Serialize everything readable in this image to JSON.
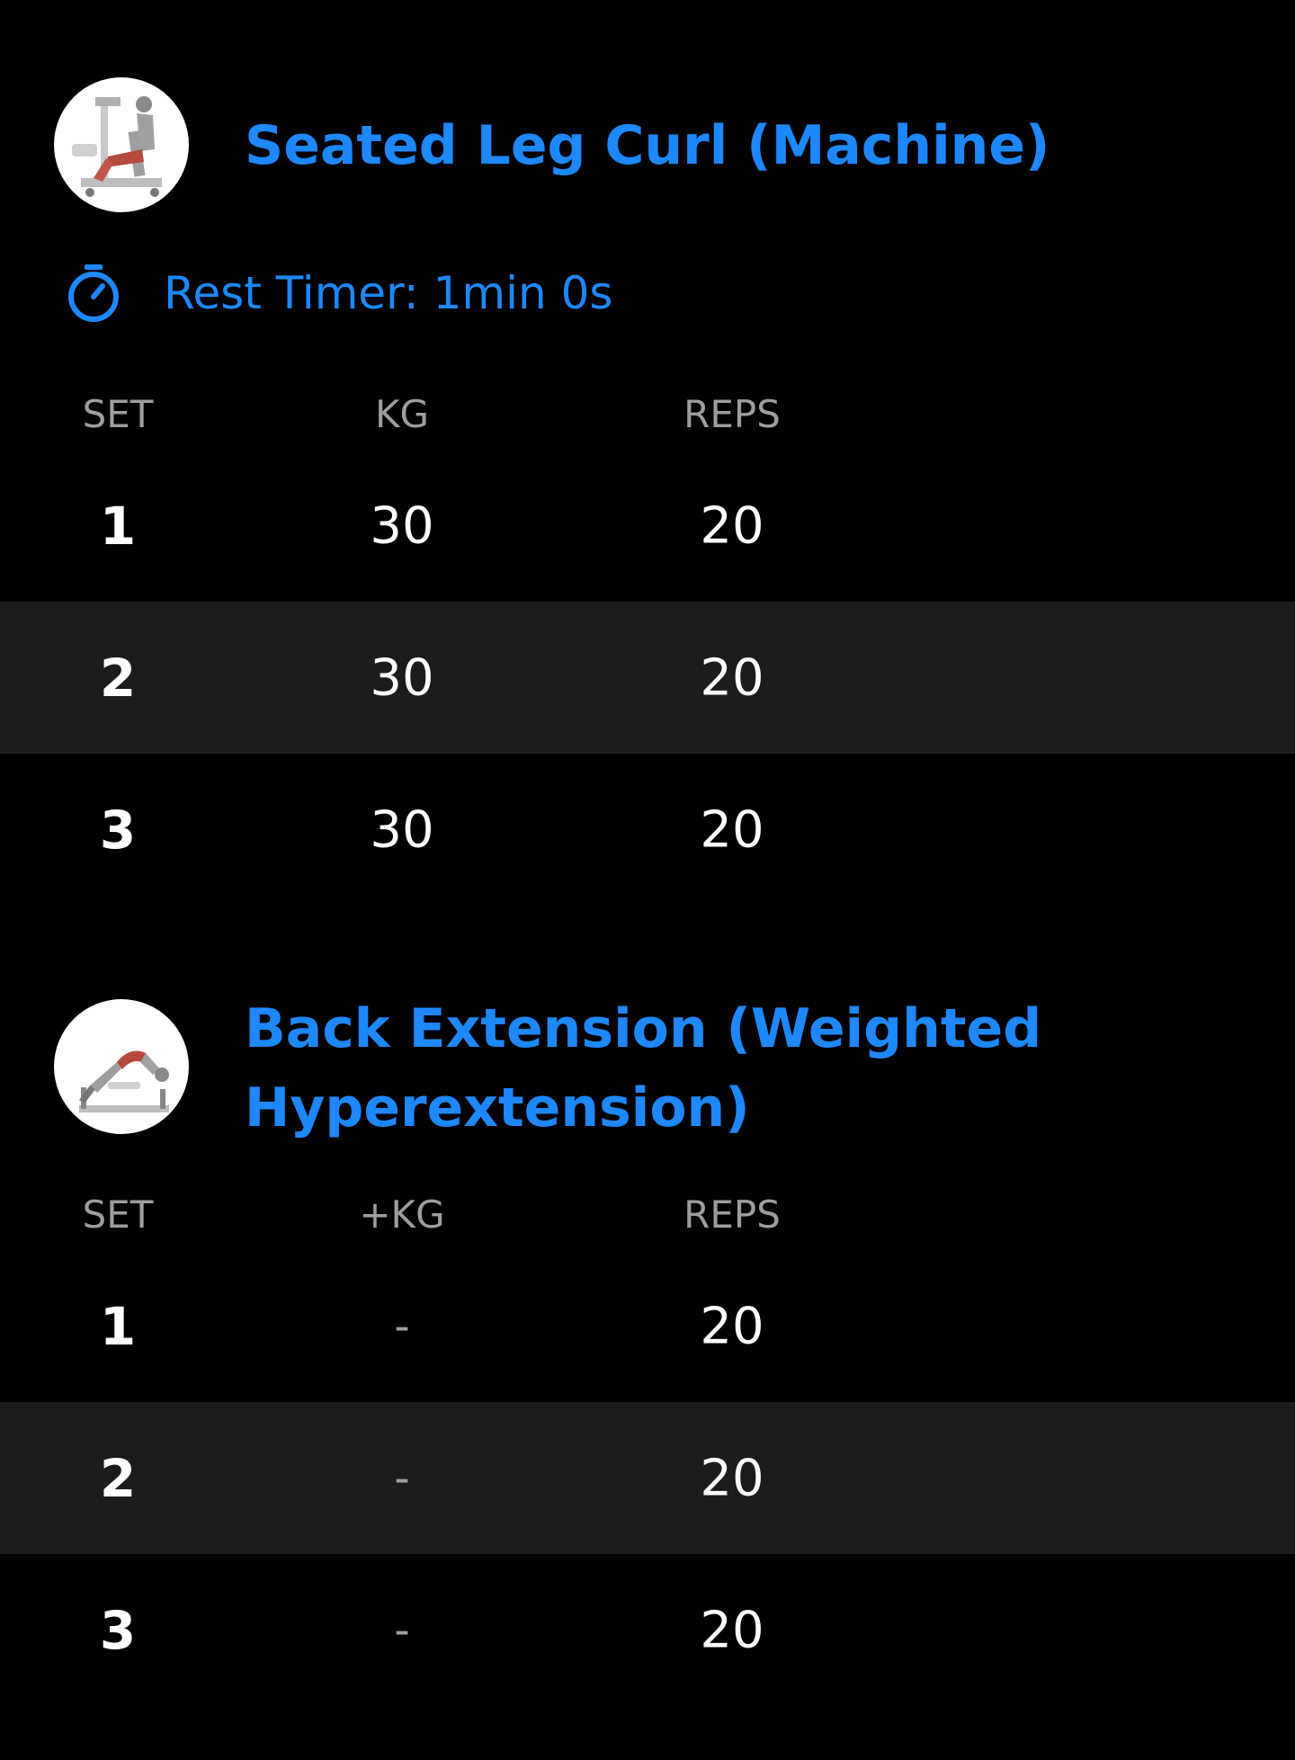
{
  "colors": {
    "background": "#000000",
    "accent": "#1e88ff",
    "row_alt": "#1c1c1e",
    "header_text": "#9e9e9e",
    "text": "#ffffff"
  },
  "exercises": [
    {
      "title": "Seated Leg Curl (Machine)",
      "thumbnail": "seated-leg-curl-illustration",
      "rest_timer": "Rest Timer: 1min 0s",
      "rest_icon": "stopwatch-icon",
      "columns": [
        "SET",
        "KG",
        "REPS"
      ],
      "sets": [
        {
          "set": "1",
          "kg": "30",
          "reps": "20"
        },
        {
          "set": "2",
          "kg": "30",
          "reps": "20"
        },
        {
          "set": "3",
          "kg": "30",
          "reps": "20"
        }
      ]
    },
    {
      "title": "Back Extension (Weighted Hyperextension)",
      "title_line1": "Back Extension (Weighted",
      "title_line2": "Hyperextension)",
      "thumbnail": "back-extension-illustration",
      "columns": [
        "SET",
        "+KG",
        "REPS"
      ],
      "sets": [
        {
          "set": "1",
          "kg": "-",
          "reps": "20"
        },
        {
          "set": "2",
          "kg": "-",
          "reps": "20"
        },
        {
          "set": "3",
          "kg": "-",
          "reps": "20"
        }
      ]
    }
  ]
}
